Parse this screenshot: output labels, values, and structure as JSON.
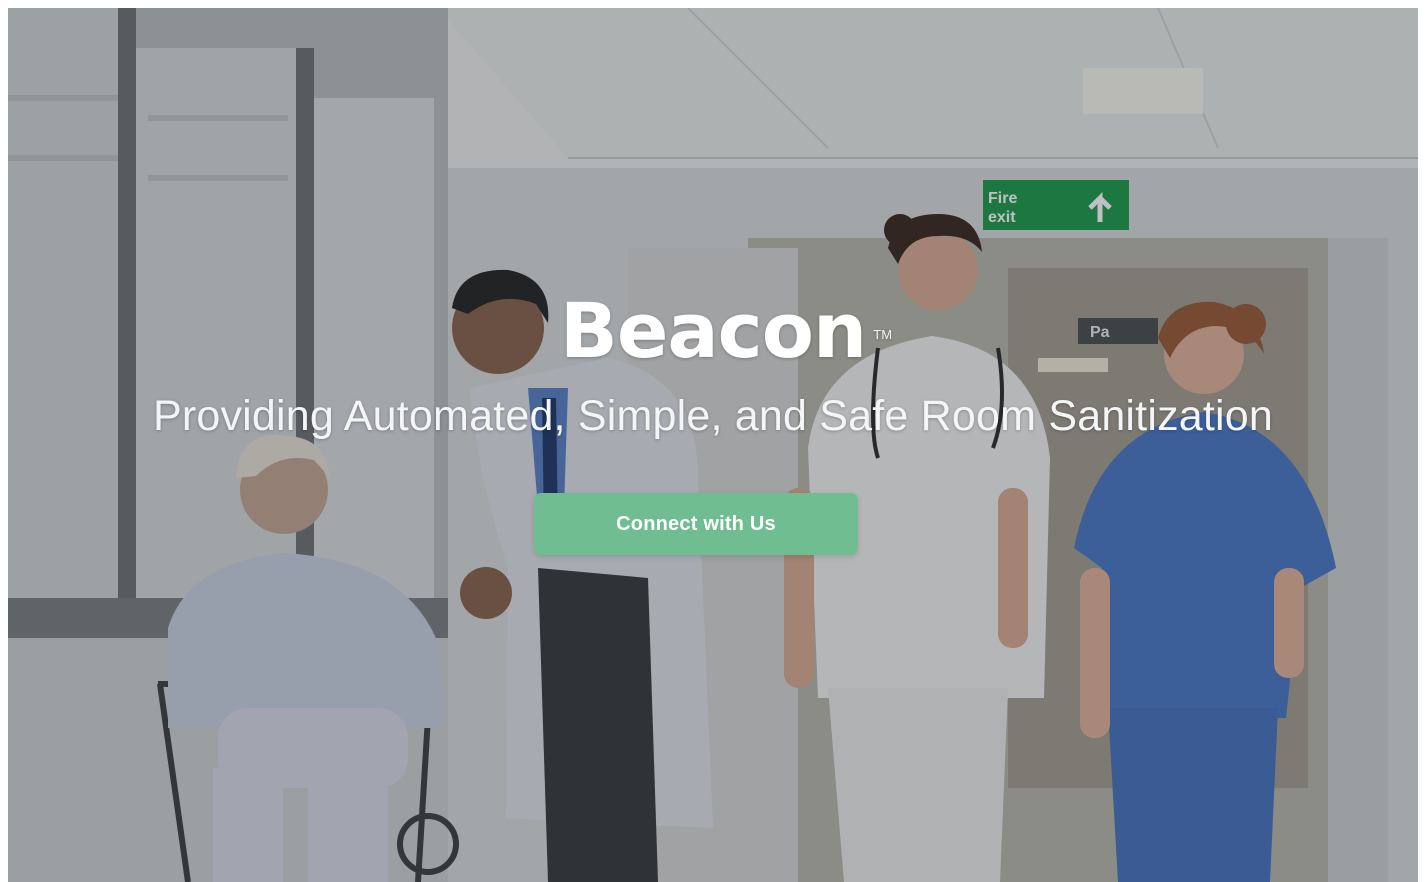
{
  "hero": {
    "brand": "Beacon",
    "trademark": "TM",
    "tagline": "Providing Automated, Simple, and Safe Room Sanitization",
    "cta_label": "Connect with Us"
  },
  "background": {
    "sign_line1": "Fire",
    "sign_line2": "exit",
    "corridor_sign": "Pa"
  },
  "colors": {
    "cta": "#6fbd91",
    "exit_sign": "#1f9a4e",
    "scrubs": "#4a79c9"
  }
}
